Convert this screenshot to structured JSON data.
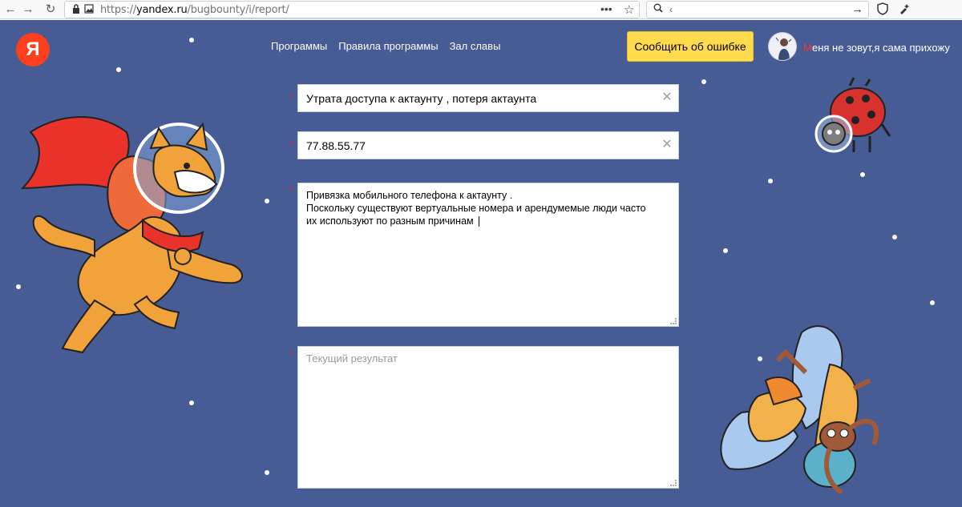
{
  "browser": {
    "url_prefix": "https://",
    "url_domain": "yandex.ru",
    "url_path": "/bugbounty/i/report/",
    "search_value": "‹",
    "icons": {
      "back": "back-arrow-icon",
      "forward": "forward-arrow-icon",
      "reload": "reload-icon",
      "lock": "lock-icon",
      "page": "page-icon",
      "more": "more-dots-icon",
      "bookmark": "star-icon",
      "search": "search-icon",
      "go": "go-arrow-icon",
      "shield": "shield-icon",
      "extension": "extension-icon"
    }
  },
  "header": {
    "logo_letter": "Я",
    "nav": [
      {
        "label": "Программы"
      },
      {
        "label": "Правила программы"
      },
      {
        "label": "Зал славы"
      }
    ],
    "report_button": "Сообщить об ошибке",
    "user_first_letter": "М",
    "user_rest": "еня не зовут,я сама прихожу"
  },
  "form": {
    "required_mark": "*",
    "title_value": "Утрата  доступа к актаунту , потеря актаунта",
    "ip_value": "77.88.55.77",
    "description_value": "Привязка мобильного телефона к актаунту .\nПоскольку существуют вертуальные номера и арендумемые люди часто\nих используют по разным причинам",
    "result_placeholder": "Текущий результат"
  },
  "colors": {
    "page_bg": "#475b94",
    "accent_yellow": "#ffdb4d",
    "logo_red": "#fc3f1d",
    "required_red": "#d2213f"
  }
}
